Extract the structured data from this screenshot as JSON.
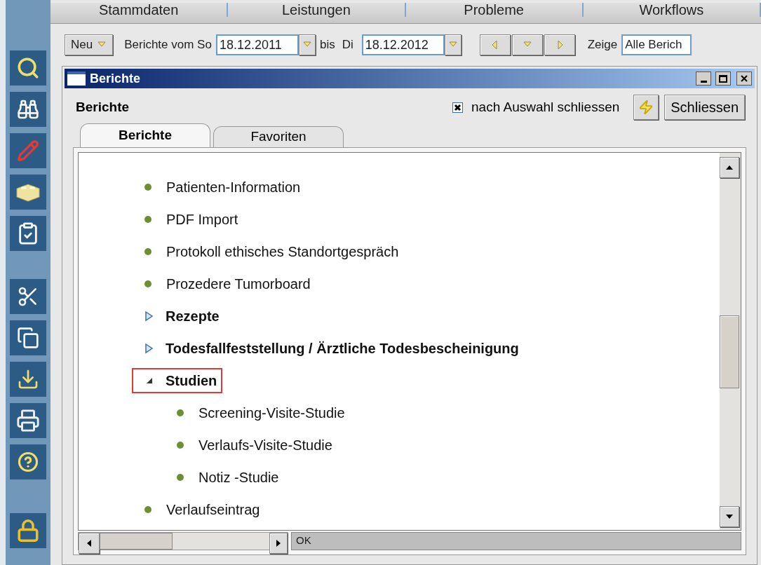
{
  "top_tabs": [
    {
      "label": "Stammdaten"
    },
    {
      "label": "Leistungen"
    },
    {
      "label": "Probleme"
    },
    {
      "label": "Workflows"
    }
  ],
  "toolbar": {
    "new_button": "Neu",
    "range_label": "Berichte vom So",
    "from_date": "18.12.2011",
    "to_label": "bis",
    "to_day": "Di",
    "to_date": "18.12.2012",
    "show_label": "Zeige",
    "show_value": "Alle Berich"
  },
  "dialog": {
    "title": "Berichte",
    "heading": "Berichte",
    "close_after_select": {
      "label": "nach Auswahl schliessen",
      "checked": true
    },
    "close_button": "Schliessen",
    "tabs": [
      {
        "label": "Berichte",
        "selected": true
      },
      {
        "label": "Favoriten",
        "selected": false
      }
    ],
    "tree": [
      {
        "label": "Patienten-Information",
        "kind": "report",
        "selected": false
      },
      {
        "label": "PDF Import",
        "kind": "report",
        "selected": false
      },
      {
        "label": "Protokoll ethisches Standortgespräch",
        "kind": "report",
        "selected": false
      },
      {
        "label": "Prozedere Tumorboard",
        "kind": "report",
        "selected": false
      },
      {
        "label": "Rezepte",
        "kind": "folder",
        "expanded": false,
        "selected": false
      },
      {
        "label": "Todesfallfeststellung / Ärztliche Todesbescheinigung",
        "kind": "folder",
        "expanded": false,
        "selected": false
      },
      {
        "label": "Studien",
        "kind": "folder",
        "expanded": true,
        "selected": true,
        "children": [
          {
            "label": "Screening-Visite-Studie",
            "kind": "report",
            "selected": false
          },
          {
            "label": "Verlaufs-Visite-Studie",
            "kind": "report",
            "selected": false
          },
          {
            "label": "Notiz -Studie",
            "kind": "report",
            "selected": false
          }
        ]
      },
      {
        "label": "Verlaufseintrag",
        "kind": "report",
        "selected": false
      }
    ],
    "status": "OK"
  }
}
